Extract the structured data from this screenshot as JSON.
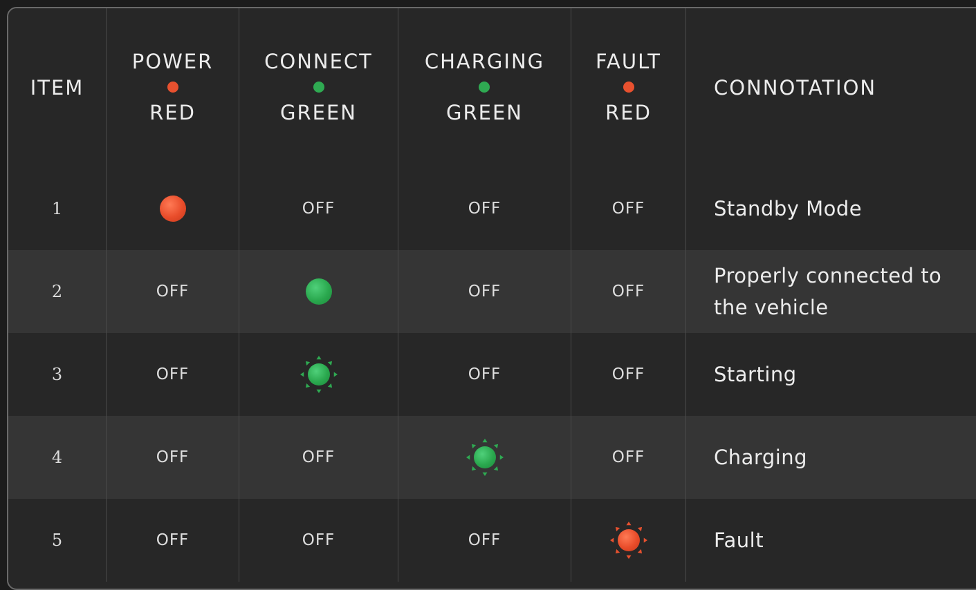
{
  "header": {
    "item": "ITEM",
    "power": {
      "title": "POWER",
      "color": "RED",
      "dot_color": "#e8512f"
    },
    "connect": {
      "title": "CONNECT",
      "color": "GREEN",
      "dot_color": "#2faa52"
    },
    "charging": {
      "title": "CHARGING",
      "color": "GREEN",
      "dot_color": "#2faa52"
    },
    "fault": {
      "title": "FAULT",
      "color": "RED",
      "dot_color": "#e8512f"
    },
    "connotation": "CONNOTATION"
  },
  "rows": [
    {
      "item": "1",
      "power": "lamp-red-on",
      "connect": "OFF",
      "charging": "OFF",
      "fault": "OFF",
      "connotation": [
        "Standby Mode"
      ]
    },
    {
      "item": "2",
      "power": "OFF",
      "connect": "lamp-green-on",
      "charging": "OFF",
      "fault": "OFF",
      "connotation": [
        "Properly connected to",
        "the vehicle"
      ]
    },
    {
      "item": "3",
      "power": "OFF",
      "connect": "lamp-green-blinking",
      "charging": "OFF",
      "fault": "OFF",
      "connotation": [
        "Starting"
      ]
    },
    {
      "item": "4",
      "power": "OFF",
      "connect": "OFF",
      "charging": "lamp-green-blinking",
      "fault": "OFF",
      "connotation": [
        "Charging"
      ]
    },
    {
      "item": "5",
      "power": "OFF",
      "connect": "OFF",
      "charging": "OFF",
      "fault": "lamp-red-blinking",
      "connotation": [
        "Fault"
      ]
    }
  ],
  "colors": {
    "background": "#272727",
    "row_alt": "#353535",
    "red": "#e8512f",
    "green": "#2faa52",
    "text": "#ececec"
  }
}
